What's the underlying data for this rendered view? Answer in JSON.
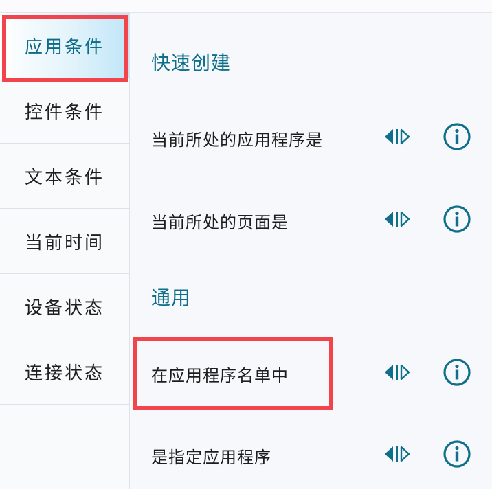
{
  "sidebar": {
    "items": [
      {
        "label": "应用条件",
        "active": true
      },
      {
        "label": "控件条件",
        "active": false
      },
      {
        "label": "文本条件",
        "active": false
      },
      {
        "label": "当前时间",
        "active": false
      },
      {
        "label": "设备状态",
        "active": false
      },
      {
        "label": "连接状态",
        "active": false
      }
    ]
  },
  "main": {
    "section_quick": "快速创建",
    "section_general": "通用",
    "rows": [
      {
        "label": "当前所处的应用程序是",
        "arrow_icon": "diamond-arrows-icon",
        "info_icon": "info-circle-icon"
      },
      {
        "label": "当前所处的页面是",
        "arrow_icon": "diamond-arrows-icon",
        "info_icon": "info-circle-icon"
      },
      {
        "label": "在应用程序名单中",
        "arrow_icon": "diamond-arrows-icon",
        "info_icon": "info-circle-icon"
      },
      {
        "label": "是指定应用程序",
        "arrow_icon": "diamond-arrows-icon",
        "info_icon": "info-circle-icon"
      }
    ]
  },
  "colors": {
    "accent": "#0e6f8a",
    "highlight": "#f2444c",
    "active_bg": "#bfe6f8"
  }
}
